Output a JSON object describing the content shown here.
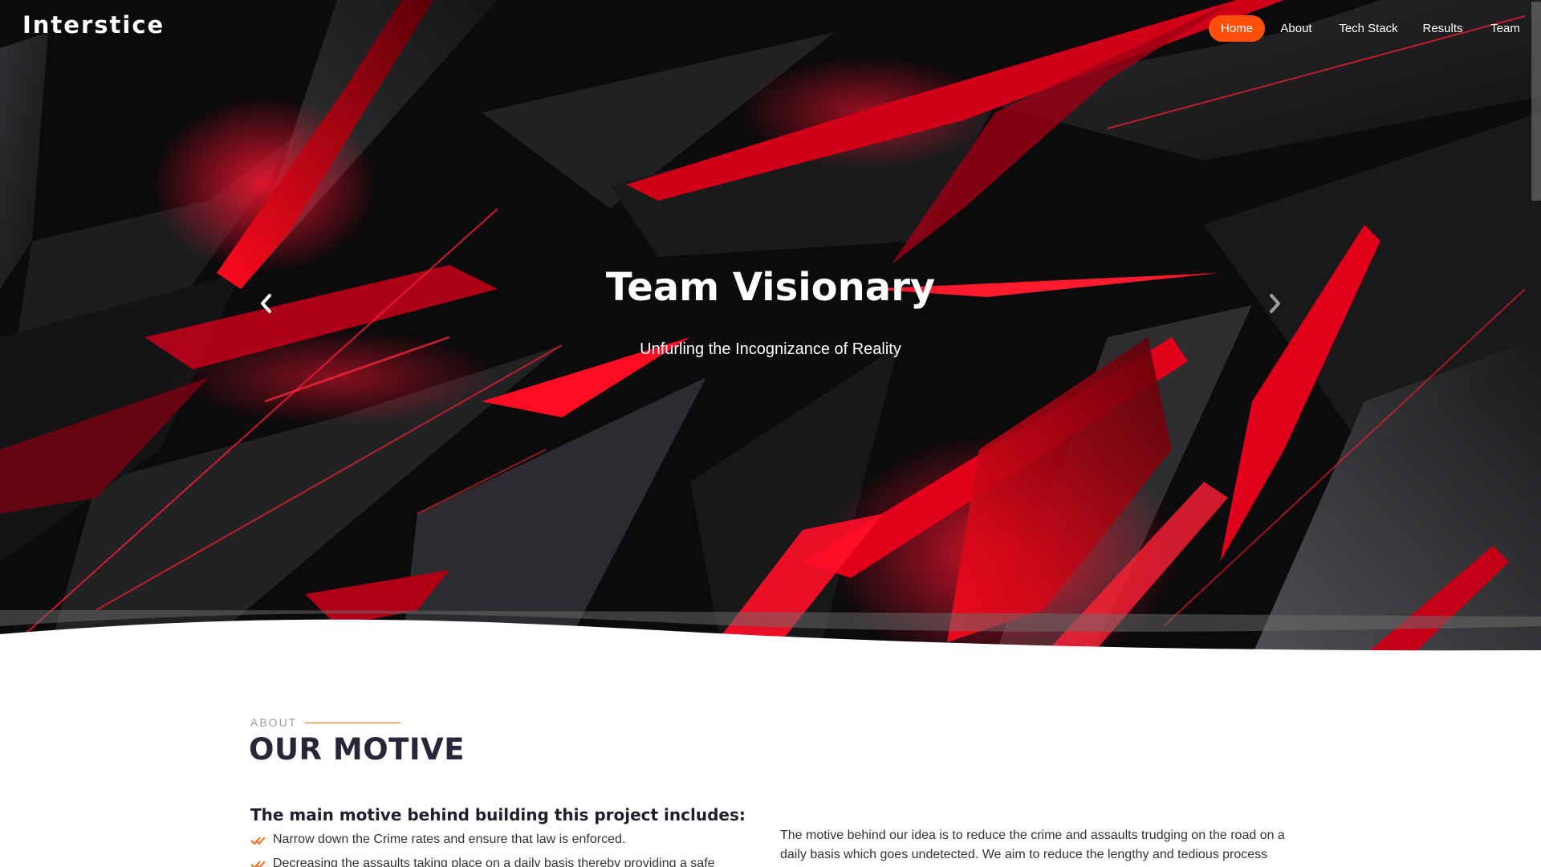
{
  "header": {
    "logo": "Interstice",
    "nav": [
      {
        "label": "Home",
        "active": true
      },
      {
        "label": "About",
        "active": false
      },
      {
        "label": "Tech Stack",
        "active": false
      },
      {
        "label": "Results",
        "active": false
      },
      {
        "label": "Team",
        "active": false
      }
    ]
  },
  "hero": {
    "title": "Team Visionary",
    "subtitle": "Unfurling the Incognizance of Reality",
    "prev_icon": "chevron-left-icon",
    "next_icon": "chevron-right-icon"
  },
  "about": {
    "label": "ABOUT",
    "title": "OUR MOTIVE",
    "heading": "The main motive behind building this project includes:",
    "items": [
      "Narrow down the Crime rates and ensure that law is enforced.",
      "Decreasing the assaults taking place on a daily basis thereby providing a safe"
    ],
    "check_icon": "double-check-icon",
    "paragraph": "The motive behind our idea is to reduce the crime and assaults trudging on the road on a daily basis which goes undetected. We aim to reduce the lengthy and tedious process"
  },
  "colors": {
    "accent": "#ff4f0a",
    "title_dark": "#27263a",
    "hero_red": "#e8001a"
  }
}
